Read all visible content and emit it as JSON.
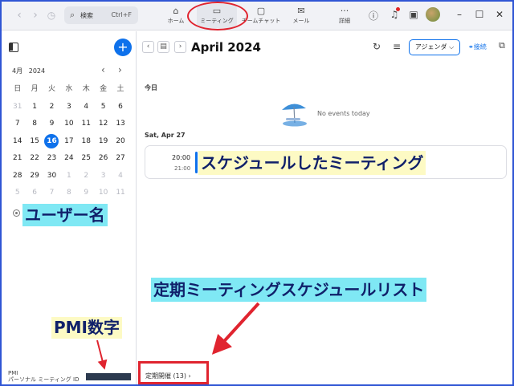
{
  "topbar": {
    "back_icon": "chevron-left-icon",
    "forward_icon": "chevron-right-icon",
    "history_icon": "history-icon",
    "search_label": "検索",
    "search_shortcut": "Ctrl+F",
    "tabs": [
      {
        "label": "ホーム",
        "icon": "home-icon"
      },
      {
        "label": "ミーティング",
        "icon": "video-camera-icon"
      },
      {
        "label": "チームチャット",
        "icon": "chat-icon"
      },
      {
        "label": "メール",
        "icon": "mail-icon"
      },
      {
        "label": "詳細",
        "icon": "more-icon"
      }
    ],
    "active_tab": "ミーティング"
  },
  "calendar": {
    "month_label": "4月",
    "year_label": "2024",
    "weekday_headers": [
      "日",
      "月",
      "火",
      "水",
      "木",
      "金",
      "土"
    ],
    "weeks": [
      [
        "31",
        "1",
        "2",
        "3",
        "4",
        "5",
        "6"
      ],
      [
        "7",
        "8",
        "9",
        "10",
        "11",
        "12",
        "13"
      ],
      [
        "14",
        "15",
        "16",
        "17",
        "18",
        "19",
        "20"
      ],
      [
        "21",
        "22",
        "23",
        "24",
        "25",
        "26",
        "27"
      ],
      [
        "28",
        "29",
        "30",
        "1",
        "2",
        "3",
        "4"
      ],
      [
        "5",
        "6",
        "7",
        "8",
        "9",
        "10",
        "11"
      ]
    ],
    "today": "16"
  },
  "pmi": {
    "label_line1": "PMI",
    "label_line2": "パーソナル ミーティング ID"
  },
  "main": {
    "period_title": "April 2024",
    "view_select": "アジェンダ ⌵",
    "connect_label": "接続",
    "today_heading": "今日",
    "no_events_text": "No events today",
    "day_heading": "Sat, Apr 27",
    "event": {
      "start": "20:00",
      "end": "21:00"
    },
    "recurring_label": "定期開催 (13)  ›"
  },
  "annotations": {
    "username": "ユーザー名",
    "pmi_number": "PMI数字",
    "scheduled_meeting": "スケジュールしたミーティング",
    "recurring_list": "定期ミーティングスケジュールリスト"
  },
  "colors": {
    "accent": "#0e71eb",
    "highlight_red": "#e0242f",
    "annotation_cyan": "#7fe8f4",
    "annotation_yellow": "#fdfac4",
    "annotation_text": "#10206a"
  }
}
